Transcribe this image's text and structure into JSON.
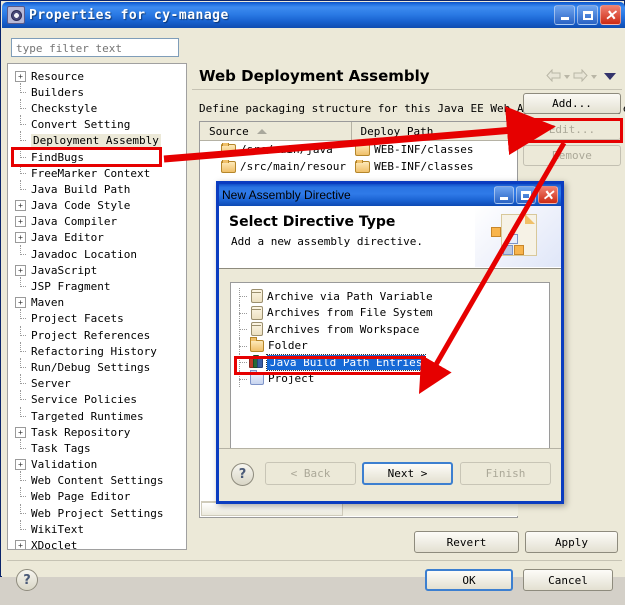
{
  "window": {
    "title": "Properties for cy-manage",
    "icon": "gear-icon",
    "buttons": {
      "minimize": "–",
      "maximize": "□",
      "close": "✕"
    }
  },
  "sidebar": {
    "filter_placeholder": "type filter text",
    "items": [
      {
        "label": "Resource",
        "expandable": true
      },
      {
        "label": "Builders",
        "expandable": false
      },
      {
        "label": "Checkstyle",
        "expandable": false
      },
      {
        "label": "Convert Setting",
        "expandable": false
      },
      {
        "label": "Deployment Assembly",
        "expandable": false,
        "selected": true
      },
      {
        "label": "FindBugs",
        "expandable": false
      },
      {
        "label": "FreeMarker Context",
        "expandable": false
      },
      {
        "label": "Java Build Path",
        "expandable": false
      },
      {
        "label": "Java Code Style",
        "expandable": true
      },
      {
        "label": "Java Compiler",
        "expandable": true
      },
      {
        "label": "Java Editor",
        "expandable": true
      },
      {
        "label": "Javadoc Location",
        "expandable": false
      },
      {
        "label": "JavaScript",
        "expandable": true
      },
      {
        "label": "JSP Fragment",
        "expandable": false
      },
      {
        "label": "Maven",
        "expandable": true
      },
      {
        "label": "Project Facets",
        "expandable": false
      },
      {
        "label": "Project References",
        "expandable": false
      },
      {
        "label": "Refactoring History",
        "expandable": false
      },
      {
        "label": "Run/Debug Settings",
        "expandable": false
      },
      {
        "label": "Server",
        "expandable": false
      },
      {
        "label": "Service Policies",
        "expandable": false
      },
      {
        "label": "Targeted Runtimes",
        "expandable": false
      },
      {
        "label": "Task Repository",
        "expandable": true
      },
      {
        "label": "Task Tags",
        "expandable": false
      },
      {
        "label": "Validation",
        "expandable": true
      },
      {
        "label": "Web Content Settings",
        "expandable": false
      },
      {
        "label": "Web Page Editor",
        "expandable": false
      },
      {
        "label": "Web Project Settings",
        "expandable": false
      },
      {
        "label": "WikiText",
        "expandable": false
      },
      {
        "label": "XDoclet",
        "expandable": true
      }
    ]
  },
  "main": {
    "page_title": "Web Deployment Assembly",
    "description": "Define packaging structure for this Java EE Web Application project.",
    "nav": {
      "back": "back-arrow",
      "forward": "forward-arrow",
      "menu": "view-menu-arrow"
    },
    "table": {
      "columns": [
        "Source",
        "Deploy Path"
      ],
      "sorted_column": "Source",
      "sort_direction": "ascending",
      "rows": [
        {
          "source": "/src/main/java",
          "deploy_path": "WEB-INF/classes"
        },
        {
          "source": "/src/main/resour",
          "deploy_path": "WEB-INF/classes"
        }
      ]
    },
    "side_buttons": [
      {
        "name": "add",
        "label": "Add...",
        "enabled": true
      },
      {
        "name": "edit",
        "label": "Edit...",
        "enabled": false
      },
      {
        "name": "remove",
        "label": "Remove",
        "enabled": false
      }
    ],
    "footer_buttons": [
      {
        "name": "revert",
        "label": "Revert"
      },
      {
        "name": "apply",
        "label": "Apply"
      }
    ]
  },
  "dialog": {
    "title": "New Assembly Directive",
    "heading": "Select Directive Type",
    "subheading": "Add a new assembly directive.",
    "items": [
      {
        "label": "Archive via Path Variable",
        "icon": "jar-icon",
        "selected": false
      },
      {
        "label": "Archives from File System",
        "icon": "jar-icon",
        "selected": false
      },
      {
        "label": "Archives from Workspace",
        "icon": "jar-icon",
        "selected": false
      },
      {
        "label": "Folder",
        "icon": "folder-icon",
        "selected": false
      },
      {
        "label": "Java Build Path Entries",
        "icon": "library-icon",
        "selected": true
      },
      {
        "label": "Project",
        "icon": "project-icon",
        "selected": false
      }
    ],
    "buttons": [
      {
        "name": "back",
        "label": "< Back",
        "enabled": false
      },
      {
        "name": "next",
        "label": "Next >",
        "enabled": true,
        "default": true
      },
      {
        "name": "finish",
        "label": "Finish",
        "enabled": false
      }
    ],
    "help": "?"
  },
  "dialog_footer": {
    "ok": "OK",
    "cancel": "Cancel",
    "help": "?"
  },
  "annotations": {
    "highlight_color": "#e60000",
    "boxes": [
      "Deployment Assembly",
      "Add...",
      "Java Build Path Entries"
    ],
    "arrows": [
      {
        "from": "Deployment Assembly",
        "to": "Add..."
      },
      {
        "from": "Add...",
        "to": "Java Build Path Entries"
      }
    ]
  }
}
